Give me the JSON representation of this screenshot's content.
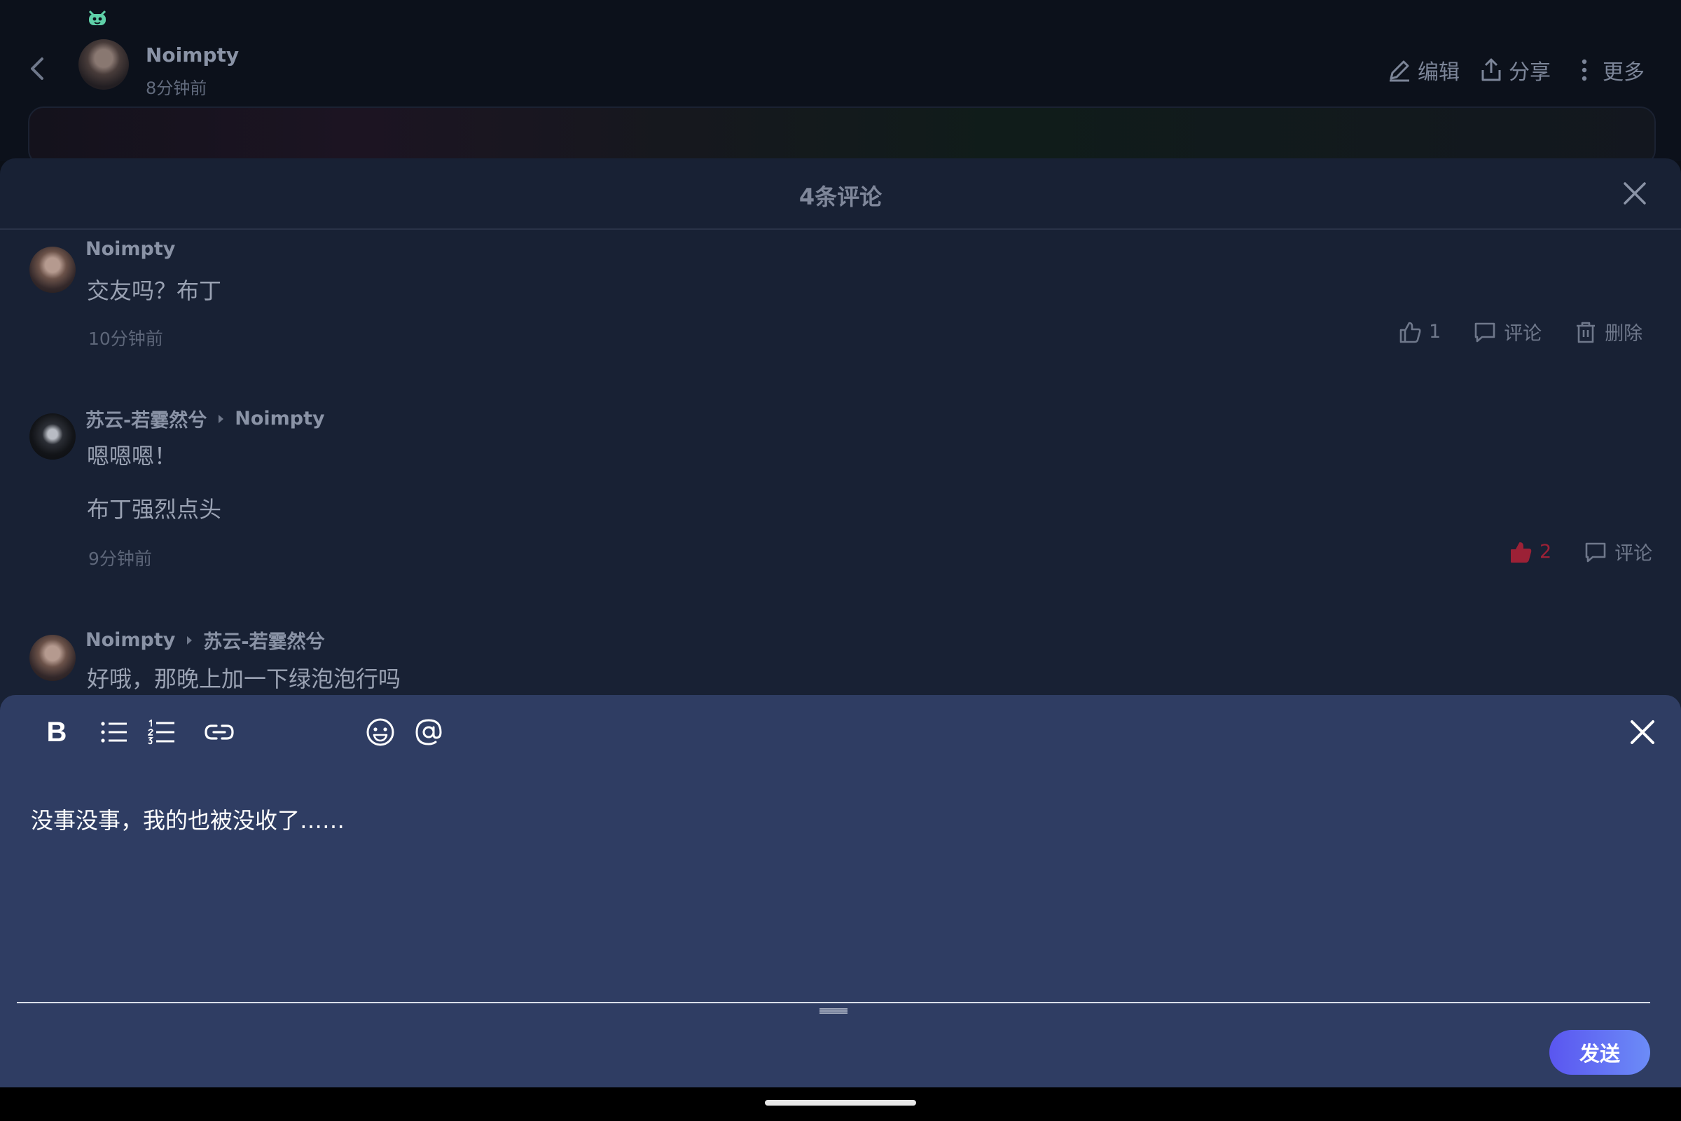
{
  "post_header": {
    "author_name": "Noimpty",
    "time": "8分钟前",
    "edit_label": "编辑",
    "share_label": "分享",
    "more_label": "更多"
  },
  "comments_sheet": {
    "title": "4条评论",
    "comments": [
      {
        "author": "Noimpty",
        "reply_to": "",
        "lines": [
          "交友吗？布丁"
        ],
        "time": "10分钟前",
        "likes": "1",
        "liked": false,
        "comment_label": "评论",
        "delete_label": "删除"
      },
      {
        "author": "苏云-若霎然兮",
        "reply_to": "Noimpty",
        "lines": [
          "嗯嗯嗯！",
          "布丁强烈点头"
        ],
        "time": "9分钟前",
        "likes": "2",
        "liked": true,
        "comment_label": "评论",
        "delete_label": ""
      },
      {
        "author": "Noimpty",
        "reply_to": "苏云-若霎然兮",
        "lines": [
          "好哦，那晚上加一下绿泡泡行吗"
        ],
        "time": "",
        "likes": "",
        "liked": false,
        "comment_label": "",
        "delete_label": ""
      }
    ]
  },
  "editor": {
    "text": "没事没事，我的也被没收了……",
    "toolbar": [
      "bold",
      "bullet-list",
      "numbered-list",
      "link",
      "emoji",
      "mention"
    ],
    "send_label": "发送"
  },
  "colors": {
    "sheet_bg": "#182134",
    "editor_bg": "#2f3d63",
    "liked": "#9c2136",
    "send_start": "#5a56f0",
    "send_end": "#6c8cf7"
  }
}
